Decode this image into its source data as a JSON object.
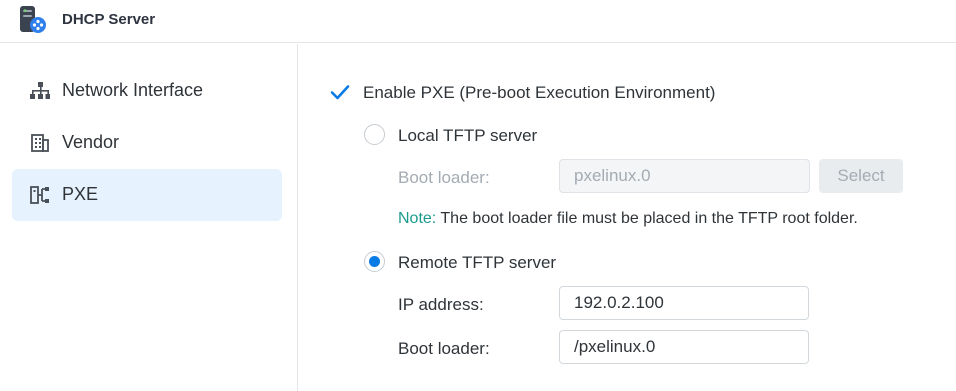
{
  "window": {
    "title": "DHCP Server",
    "icon": "dhcp-server-app-icon"
  },
  "sidebar": {
    "items": [
      {
        "label": "Network Interface",
        "icon": "network-tree-icon",
        "active": false
      },
      {
        "label": "Vendor",
        "icon": "building-icon",
        "active": false
      },
      {
        "label": "PXE",
        "icon": "pxe-icon",
        "active": true
      }
    ]
  },
  "pxe": {
    "enable_label": "Enable PXE (Pre-boot Execution Environment)",
    "enable_checked": true,
    "local": {
      "label": "Local TFTP server",
      "selected": false,
      "boot_loader_label": "Boot loader:",
      "boot_loader_value": "pxelinux.0",
      "select_button": "Select",
      "note_key": "Note:",
      "note_text": " The boot loader file must be placed in the TFTP root folder."
    },
    "remote": {
      "label": "Remote TFTP server",
      "selected": true,
      "ip_label": "IP address:",
      "ip_value": "192.0.2.100",
      "boot_loader_label": "Boot loader:",
      "boot_loader_value": "/pxelinux.0"
    }
  },
  "colors": {
    "accent": "#0a7ae5",
    "note": "#1a9b8e",
    "active_nav_bg": "#e6f2fd"
  }
}
